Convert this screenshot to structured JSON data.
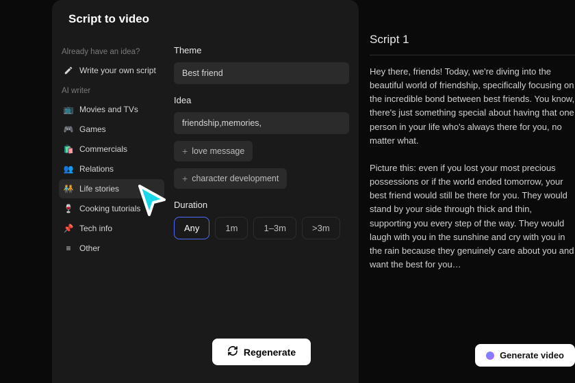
{
  "panel": {
    "title": "Script to video"
  },
  "sidebar": {
    "heading_idea": "Already have an idea?",
    "write_own": "Write your own script",
    "heading_ai": "AI writer",
    "items": [
      {
        "label": "Movies and TVs"
      },
      {
        "label": "Games"
      },
      {
        "label": "Commercials"
      },
      {
        "label": "Relations"
      },
      {
        "label": "Life stories"
      },
      {
        "label": "Cooking tutorials"
      },
      {
        "label": "Tech info"
      },
      {
        "label": "Other"
      }
    ]
  },
  "form": {
    "theme_label": "Theme",
    "theme_value": "Best friend",
    "idea_label": "Idea",
    "idea_value": "friendship,memories,",
    "suggestions": [
      "love message",
      "character development"
    ],
    "duration_label": "Duration",
    "duration_options": [
      "Any",
      "1m",
      "1–3m",
      ">3m"
    ],
    "duration_selected": "Any",
    "regenerate": "Regenerate"
  },
  "result": {
    "title": "Script 1",
    "body": "Hey there, friends! Today, we're diving into the beautiful world of friendship, specifically focusing on the incredible bond between best friends. You know, there's just something special about having that one person in your life who's always there for you, no matter what.\n\nPicture this: even if you lost your most precious possessions or if the world ended tomorrow, your best friend would still be there for you. They would stand by your side through thick and thin, supporting you every step of the way. They would laugh with you in the sunshine and cry with you in the rain because they genuinely care about you and want the best for you…",
    "generate": "Generate video"
  }
}
